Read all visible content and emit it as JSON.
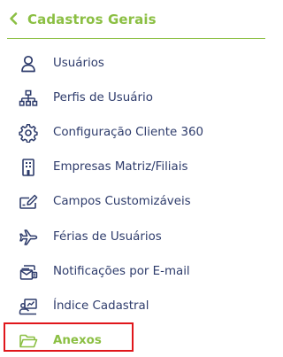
{
  "header": {
    "title": "Cadastros Gerais",
    "back_icon": "chevron-left-icon"
  },
  "menu": {
    "items": [
      {
        "label": "Usuários",
        "icon": "user-icon"
      },
      {
        "label": "Perfis de Usuário",
        "icon": "hierarchy-icon"
      },
      {
        "label": "Configuração Cliente 360",
        "icon": "gear-icon"
      },
      {
        "label": "Empresas Matriz/Filiais",
        "icon": "building-icon"
      },
      {
        "label": "Campos Customizáveis",
        "icon": "edit-field-icon"
      },
      {
        "label": "Férias de Usuários",
        "icon": "airplane-icon"
      },
      {
        "label": "Notificações por E-mail",
        "icon": "email-notification-icon"
      },
      {
        "label": "Índice Cadastral",
        "icon": "presentation-chart-icon"
      },
      {
        "label": "Anexos",
        "icon": "folder-open-icon",
        "active": true
      }
    ]
  },
  "colors": {
    "accent": "#8bbf43",
    "text": "#2d3b6b",
    "highlight": "#e0161b"
  }
}
